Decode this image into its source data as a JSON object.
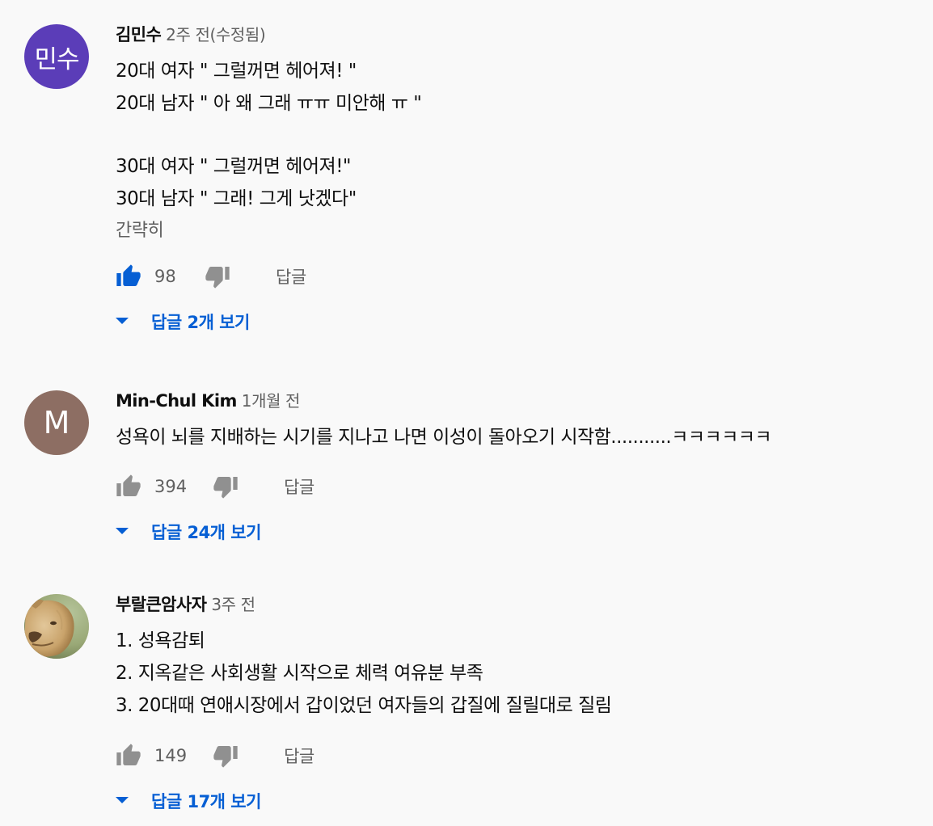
{
  "colors": {
    "background": "#f9f9f9",
    "link_blue": "#065fd4",
    "text_primary": "#0f0f0f",
    "text_secondary": "#606060",
    "liked_thumb": "#065fd4",
    "avatar_1": "#5b3db8",
    "avatar_2": "#8d6e63"
  },
  "comments": [
    {
      "author": "김민수",
      "time": "2주 전(수정됨)",
      "avatar_text": "민수",
      "lines": [
        "20대 여자 \" 그럴꺼면 헤어져! \"",
        "20대 남자 \" 아 왜 그래 ㅠㅠ 미안해 ㅠ \"",
        "",
        "30대 여자 \" 그럴꺼면 헤어져!\"",
        "30대 남자 \" 그래! 그게 낫겠다\""
      ],
      "collapse_label": "간략히",
      "likes": "98",
      "liked": true,
      "reply_label": "답글",
      "view_replies_label": "답글 2개 보기",
      "like_icon": "thumbs-up-icon",
      "dislike_icon": "thumbs-down-icon"
    },
    {
      "author": "Min-Chul Kim",
      "time": "1개월 전",
      "avatar_text": "M",
      "lines": [
        "성욕이 뇌를 지배하는 시기를 지나고 나면 이성이 돌아오기 시작함...........ㅋㅋㅋㅋㅋㅋ"
      ],
      "likes": "394",
      "liked": false,
      "reply_label": "답글",
      "view_replies_label": "답글 24개 보기",
      "like_icon": "thumbs-up-icon",
      "dislike_icon": "thumbs-down-icon"
    },
    {
      "author": "부랄큰암사자",
      "time": "3주 전",
      "avatar_icon": "lioness-photo",
      "lines": [
        "1. 성욕감퇴",
        "2. 지옥같은 사회생활 시작으로  체력 여유분 부족",
        "3. 20대때 연애시장에서 갑이었던 여자들의 갑질에 질릴대로 질림"
      ],
      "likes": "149",
      "liked": false,
      "reply_label": "답글",
      "view_replies_label": "답글 17개 보기",
      "like_icon": "thumbs-up-icon",
      "dislike_icon": "thumbs-down-icon"
    }
  ]
}
